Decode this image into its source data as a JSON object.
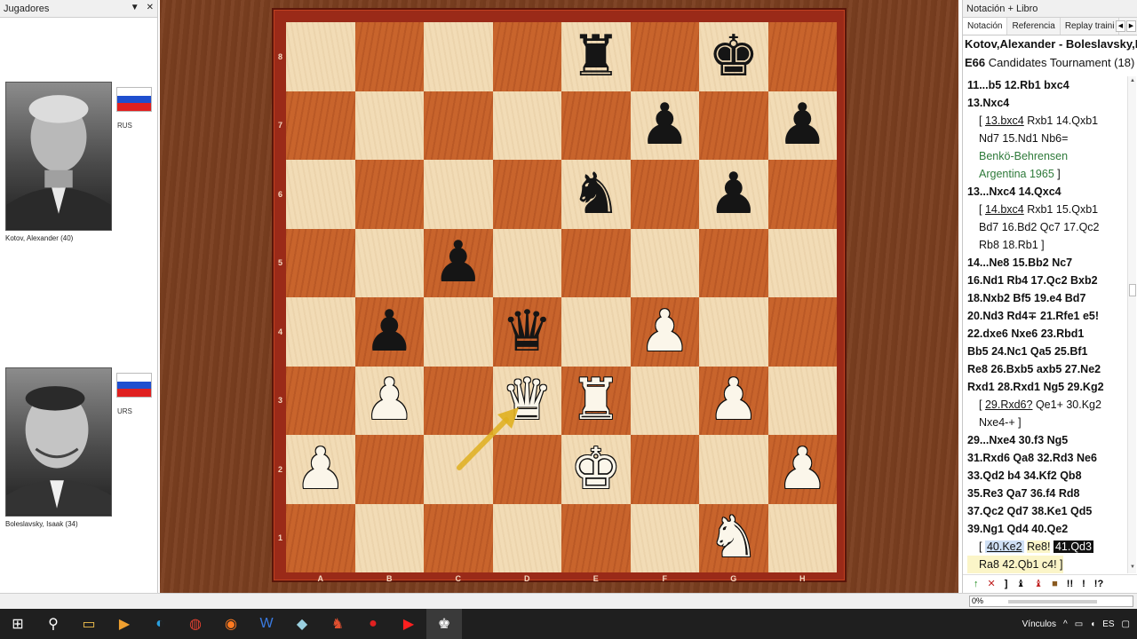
{
  "players_panel": {
    "title": "Jugadores",
    "white": {
      "name": "Kotov, Alexander  (40)",
      "country": "RUS"
    },
    "black": {
      "name": "Boleslavsky, Isaak  (34)",
      "country": "URS"
    },
    "flag_colors": [
      "#ffffff",
      "#1f4fcf",
      "#e02020"
    ]
  },
  "board": {
    "files": [
      "A",
      "B",
      "C",
      "D",
      "E",
      "F",
      "G",
      "H"
    ],
    "ranks": [
      "8",
      "7",
      "6",
      "5",
      "4",
      "3",
      "2",
      "1"
    ],
    "light_color": "#f2dcb6",
    "dark_color": "#c8642c",
    "frame_color": "#9a2a18",
    "rows": [
      [
        "",
        "",
        "",
        "",
        "r",
        "",
        "k",
        ""
      ],
      [
        "",
        "",
        "",
        "",
        "",
        "p",
        "",
        "p"
      ],
      [
        "",
        "",
        "",
        "",
        "n",
        "",
        "p",
        ""
      ],
      [
        "",
        "",
        "p",
        "",
        "",
        "",
        "",
        ""
      ],
      [
        "",
        "p",
        "",
        "q",
        "",
        "P",
        "",
        ""
      ],
      [
        "",
        "P",
        "",
        "Q",
        "R",
        "",
        "P",
        ""
      ],
      [
        "P",
        "",
        "",
        "",
        "K",
        "",
        "",
        "P"
      ],
      [
        "",
        "",
        "",
        "",
        "",
        "",
        "N",
        ""
      ]
    ],
    "last_move_arrow_color": "#e0b020"
  },
  "notation_panel": {
    "title": "Notación + Libro",
    "tabs": [
      "Notación",
      "Referencia",
      "Replay traini"
    ],
    "game_title": "Kotov,Alexander - Boleslavsky,Is",
    "eco": "E66",
    "event": "Candidates Tournament (18)",
    "toolbar": [
      "↑",
      "✕",
      "]",
      "♝",
      "♝",
      "■",
      "!!",
      "!",
      "!?"
    ]
  },
  "status": {
    "progress": "0%"
  },
  "taskbar": {
    "apps": [
      "⊞",
      "⚲",
      "▭",
      "▶",
      "◐",
      "◍",
      "◉",
      "W",
      "◆",
      "♞",
      "●",
      "▶",
      "♚"
    ],
    "tray_text": "Vínculos"
  }
}
